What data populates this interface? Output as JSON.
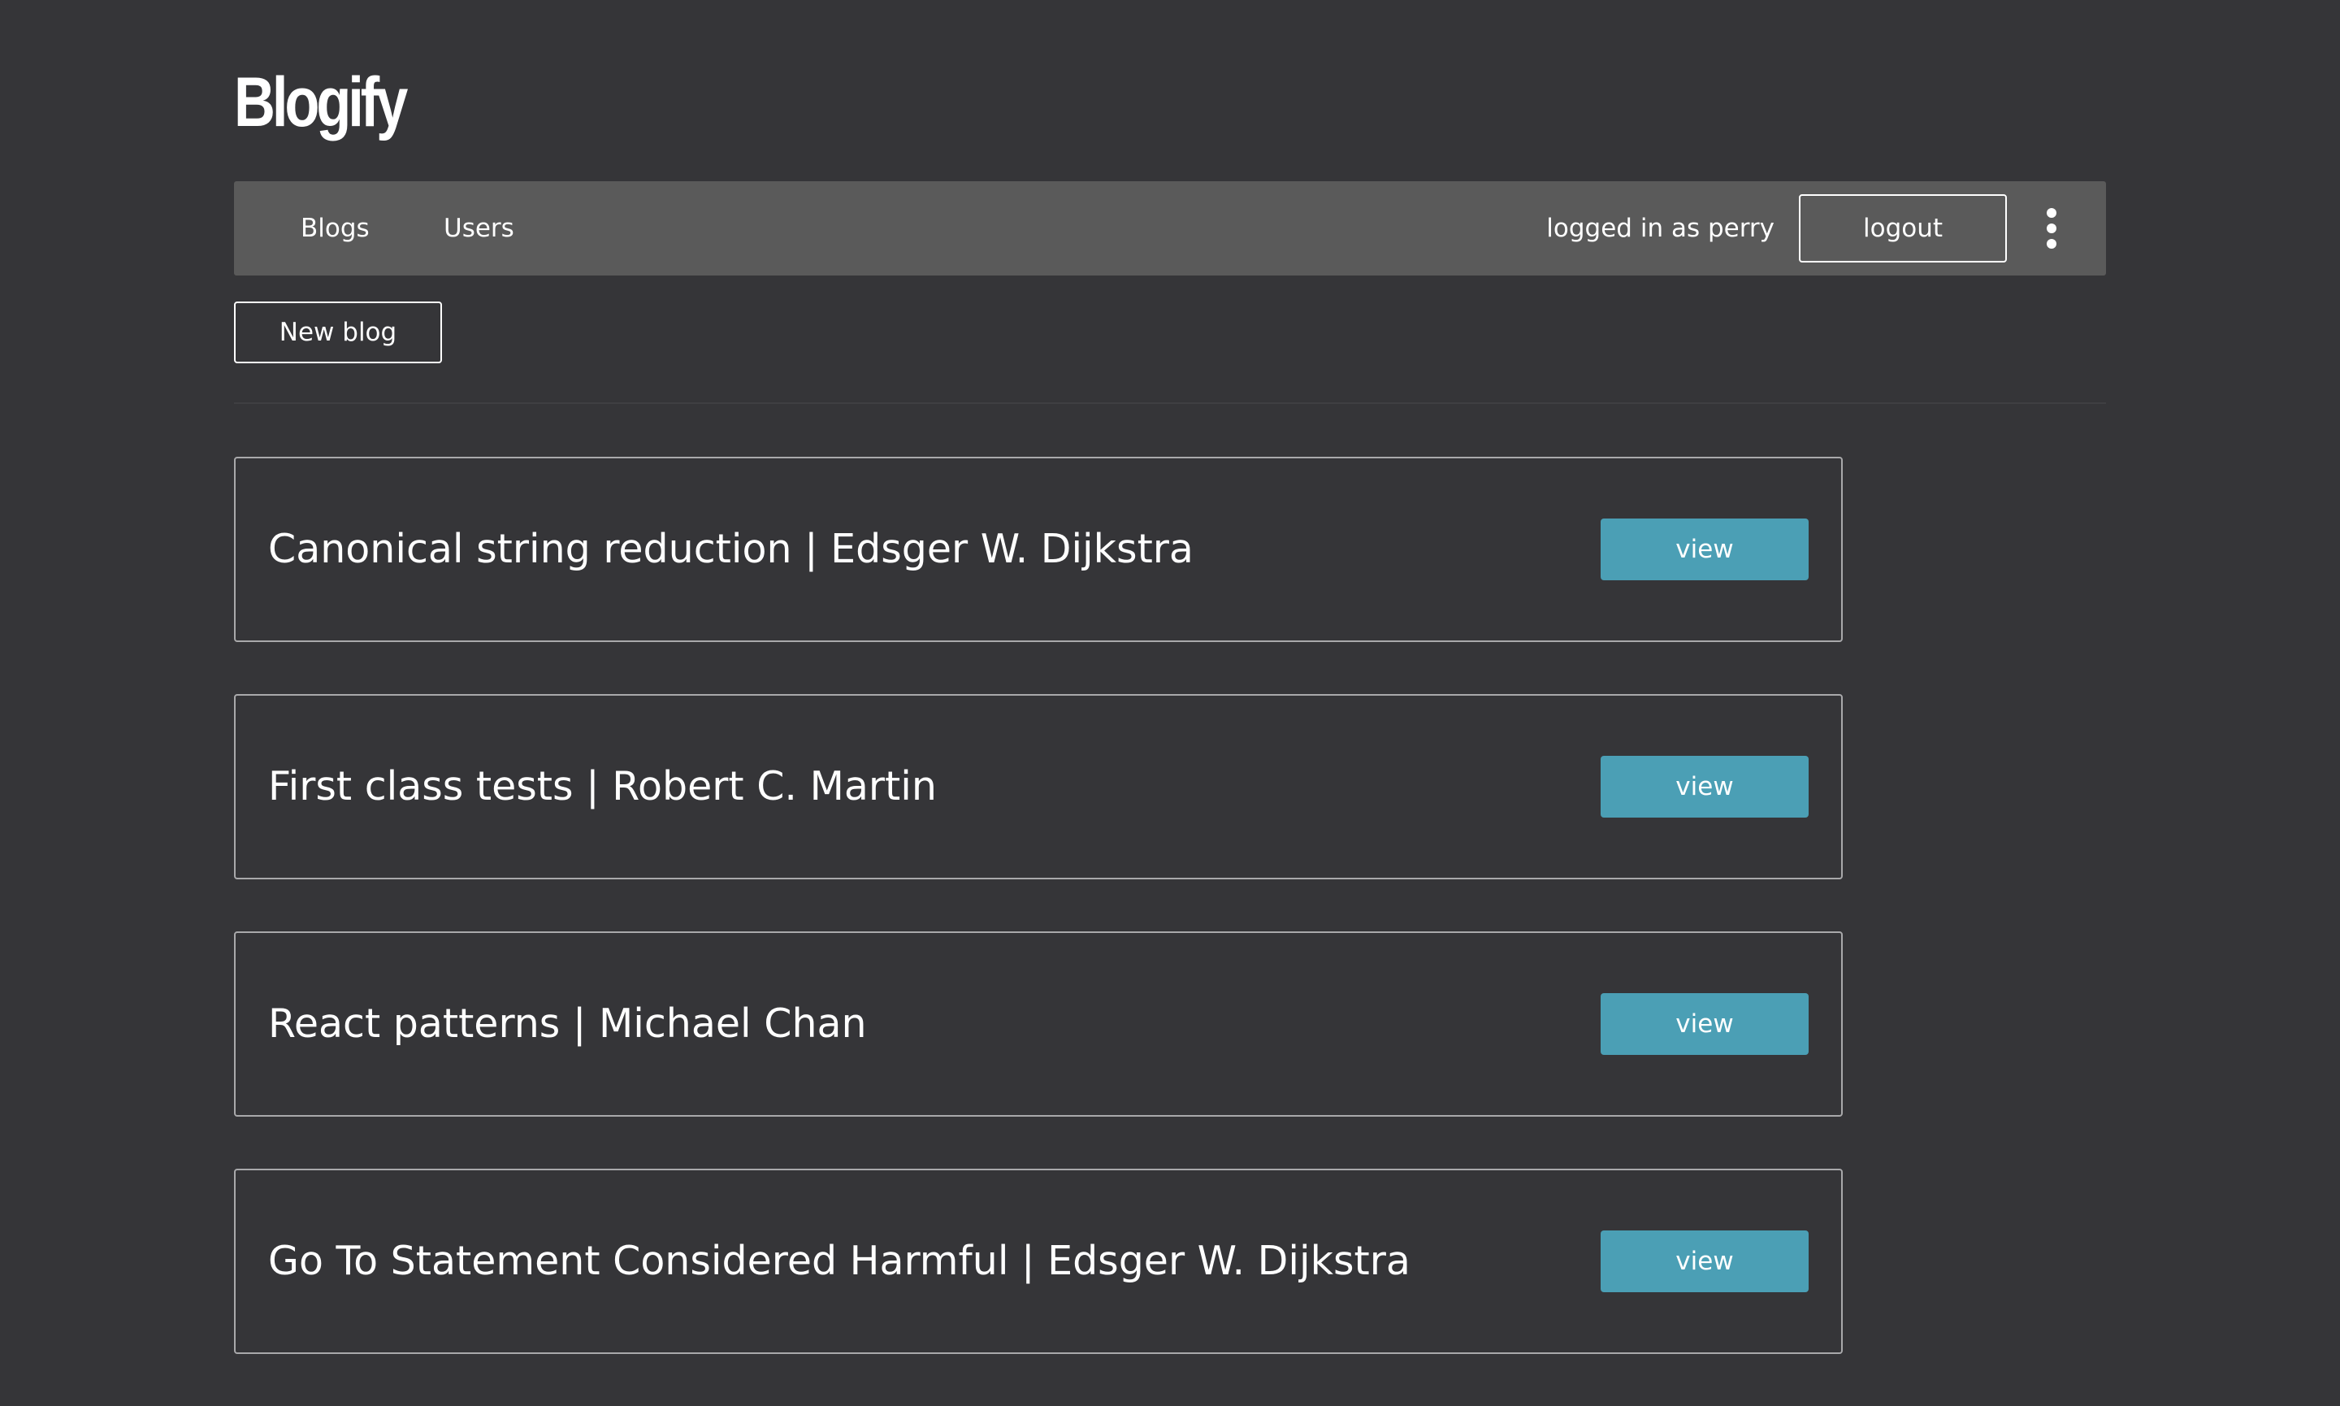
{
  "app": {
    "title": "Blogify"
  },
  "nav": {
    "links": [
      "Blogs",
      "Users"
    ],
    "login_status": "logged in as perry",
    "logout_label": "logout",
    "more_icon": "kebab-menu-icon"
  },
  "toolbar": {
    "new_blog_label": "New blog"
  },
  "blogs": [
    {
      "title": "Canonical string reduction",
      "author": "Edsger W. Dijkstra",
      "display": "Canonical string reduction | Edsger W. Dijkstra",
      "view_label": "view"
    },
    {
      "title": "First class tests",
      "author": "Robert C. Martin",
      "display": "First class tests | Robert C. Martin",
      "view_label": "view"
    },
    {
      "title": "React patterns",
      "author": "Michael Chan",
      "display": "React patterns | Michael Chan",
      "view_label": "view"
    },
    {
      "title": "Go To Statement Considered Harmful",
      "author": "Edsger W. Dijkstra",
      "display": "Go To Statement Considered Harmful | Edsger W. Dijkstra",
      "view_label": "view"
    }
  ],
  "colors": {
    "background": "#353538",
    "navbar": "#5a5a5a",
    "view_button": "#4b9fb5",
    "card_border": "#a9a9ab",
    "text": "#ffffff"
  }
}
